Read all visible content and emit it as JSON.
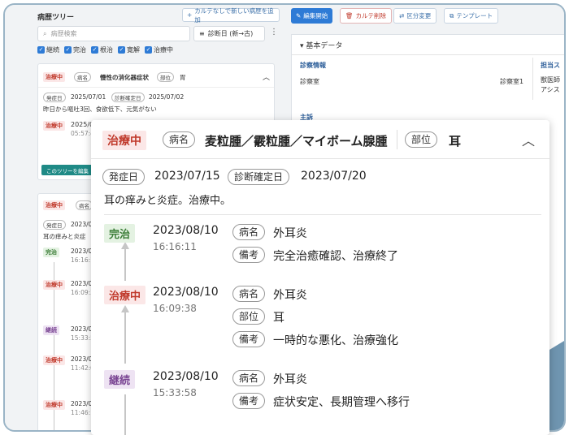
{
  "left": {
    "title": "病歴ツリー",
    "add_button": "カルテなしで新しい病歴を追加",
    "search_placeholder": "病歴検索",
    "sort_label": "診断日 (新→古)",
    "filters": [
      "継続",
      "完治",
      "根治",
      "寛解",
      "治療中"
    ],
    "card1": {
      "status": "治療中",
      "name_label": "病名",
      "name": "慢性の消化器症状",
      "part_label": "部位",
      "part": "胃",
      "onset_label": "発症日",
      "onset": "2025/07/01",
      "diag_label": "診断確定日",
      "diag": "2025/07/02",
      "note": "昨日から嘔吐3回、食欲低下、元気がない",
      "child_status": "治療中",
      "child_date": "2025/07",
      "child_time": "05:57:4",
      "edit_button": "このツリーを編集"
    },
    "card2": {
      "status": "治療中",
      "name_label": "病名",
      "onset_label": "発症日",
      "onset": "2023/07",
      "note": "耳の痒みと炎症",
      "entries": [
        {
          "status": "完治",
          "date": "2023/0",
          "time": "16:16:1"
        },
        {
          "status": "治療中",
          "date": "2023/0",
          "time": "16:09:3"
        },
        {
          "status": "継続",
          "date": "2023/0",
          "time": "15:33:5"
        },
        {
          "status": "治療中",
          "date": "2023/0",
          "time": "11:42:0"
        },
        {
          "status": "治療中",
          "date": "2023/0",
          "time": "11:46:1"
        },
        {
          "status": "治療中",
          "date": "2023/0",
          "time": "11:48:"
        }
      ]
    }
  },
  "right": {
    "toolbar": {
      "edit": "編集開始",
      "delete": "カルテ削除",
      "change": "区分変更",
      "template": "テンプレート"
    },
    "basic_title": "基本データ",
    "clinic_info": "診察情報",
    "room_label": "診察室",
    "room_value": "診察室1",
    "staff_title": "担当ス",
    "staff_line1": "獣医師",
    "staff_line2": "アシス",
    "chief": "主訴"
  },
  "popup": {
    "status": "治療中",
    "name_label": "病名",
    "name": "麦粒腫／霰粒腫／マイボーム腺腫",
    "part_label": "部位",
    "part": "耳",
    "onset_label": "発症日",
    "onset": "2023/07/15",
    "diag_label": "診断確定日",
    "diag": "2023/07/20",
    "note": "耳の痒みと炎症。治療中。",
    "entries": [
      {
        "status": "完治",
        "date": "2023/08/10",
        "time": "16:16:11",
        "rows": [
          {
            "label": "病名",
            "value": "外耳炎"
          },
          {
            "label": "備考",
            "value": "完全治癒確認、治療終了"
          }
        ]
      },
      {
        "status": "治療中",
        "date": "2023/08/10",
        "time": "16:09:38",
        "rows": [
          {
            "label": "病名",
            "value": "外耳炎"
          },
          {
            "label": "部位",
            "value": "耳"
          },
          {
            "label": "備考",
            "value": "一時的な悪化、治療強化"
          }
        ]
      },
      {
        "status": "継続",
        "date": "2023/08/10",
        "time": "15:33:58",
        "rows": [
          {
            "label": "病名",
            "value": "外耳炎"
          },
          {
            "label": "備考",
            "value": "症状安定、長期管理へ移行"
          }
        ]
      }
    ]
  },
  "colors": {
    "accent": "#2e7bd6",
    "danger": "#c0392b",
    "ok": "#3b7d37",
    "continue": "#7a4593",
    "corner": "#6f95b0"
  },
  "icons": [
    "plus-icon",
    "search-icon",
    "sort-icon",
    "kebab-icon",
    "chevron-up-icon",
    "edit-icon",
    "trash-icon",
    "swap-icon",
    "template-icon",
    "folder-add-icon"
  ]
}
